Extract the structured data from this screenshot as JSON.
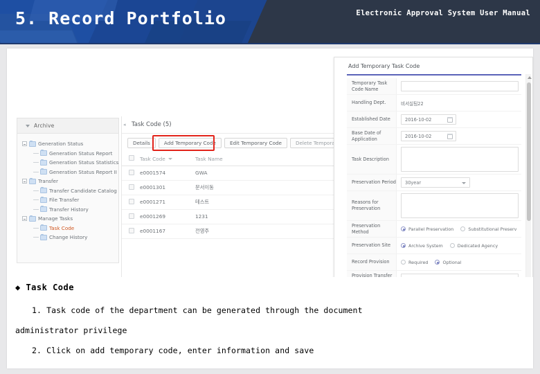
{
  "header": {
    "slide_title": "5. Record Portfolio",
    "manual_label": "Electronic Approval System User Manual"
  },
  "tree_panel": {
    "header_label": "Archive",
    "nodes": [
      {
        "label": "Generation Status",
        "level": 1,
        "selected": false,
        "expandable": true
      },
      {
        "label": "Generation Status Report",
        "level": 2,
        "selected": false,
        "expandable": false
      },
      {
        "label": "Generation Status Statistics",
        "level": 2,
        "selected": false,
        "expandable": false
      },
      {
        "label": "Generation Status Report II",
        "level": 2,
        "selected": false,
        "expandable": false
      },
      {
        "label": "Transfer",
        "level": 1,
        "selected": false,
        "expandable": true
      },
      {
        "label": "Transfer Candidate Catalog",
        "level": 2,
        "selected": false,
        "expandable": false
      },
      {
        "label": "File Transfer",
        "level": 2,
        "selected": false,
        "expandable": false
      },
      {
        "label": "Transfer History",
        "level": 2,
        "selected": false,
        "expandable": false
      },
      {
        "label": "Manage Tasks",
        "level": 1,
        "selected": false,
        "expandable": true
      },
      {
        "label": "Task Code",
        "level": 2,
        "selected": true,
        "expandable": false
      },
      {
        "label": "Change History",
        "level": 2,
        "selected": false,
        "expandable": false
      }
    ]
  },
  "main_panel": {
    "title": "Task Code (5)",
    "toolbar": [
      {
        "label": "Details",
        "highlighted": false,
        "enabled": true
      },
      {
        "label": "Add Temporary Code",
        "highlighted": true,
        "enabled": true
      },
      {
        "label": "Edit Temporary Code",
        "highlighted": false,
        "enabled": true
      },
      {
        "label": "Delete Temporary Code",
        "highlighted": false,
        "enabled": false
      }
    ],
    "columns": [
      "Task Code",
      "Task Name"
    ],
    "rows": [
      {
        "code": "e0001574",
        "name": "GWA"
      },
      {
        "code": "e0001301",
        "name": "문서이동"
      },
      {
        "code": "e0001271",
        "name": "테스트"
      },
      {
        "code": "e0001269",
        "name": "1231"
      },
      {
        "code": "e0001167",
        "name": "전영주"
      }
    ]
  },
  "dialog": {
    "title": "Add Temporary Task Code",
    "fields": {
      "temp_code_name_label": "Temporary Task Code Name",
      "temp_code_name_value": "",
      "handling_dept_label": "Handling Dept.",
      "handling_dept_value": "비서실팀22",
      "established_date_label": "Established Date",
      "established_date_value": "2016-10-02",
      "base_date_label": "Base Date of Application",
      "base_date_value": "2016-10-02",
      "task_description_label": "Task Description",
      "task_description_value": "",
      "preservation_period_label": "Preservation Period",
      "preservation_period_value": "30year",
      "reasons_label": "Reasons for Preservation",
      "reasons_value": "",
      "preservation_method_label": "Preservation Method",
      "preservation_method_options": [
        "Parallel Preservation",
        "Substitutional Preserv"
      ],
      "preservation_method_selected": 0,
      "preservation_site_label": "Preservation Site",
      "preservation_site_options": [
        "Archive System",
        "Dedicated Agency"
      ],
      "preservation_site_selected": 0,
      "record_provision_label": "Record Provision",
      "record_provision_options": [
        "Required",
        "Optional"
      ],
      "record_provision_selected": 1,
      "provision_transfer_label": "Provision Transfer Period",
      "provision_transfer_value": ""
    }
  },
  "notes": {
    "heading": "◆ Task Code",
    "line1a": "1. Task code of the department can be generated through the document",
    "line1b": "administrator privilege",
    "line2": "2. Click on add temporary code, enter information and save"
  },
  "colors": {
    "header_bg": "#2d3748",
    "header_accent": "#1e4fa3",
    "selected_tree_item": "#d0561f",
    "highlight_box": "#e2231a",
    "dialog_accent": "#5a63b8"
  }
}
